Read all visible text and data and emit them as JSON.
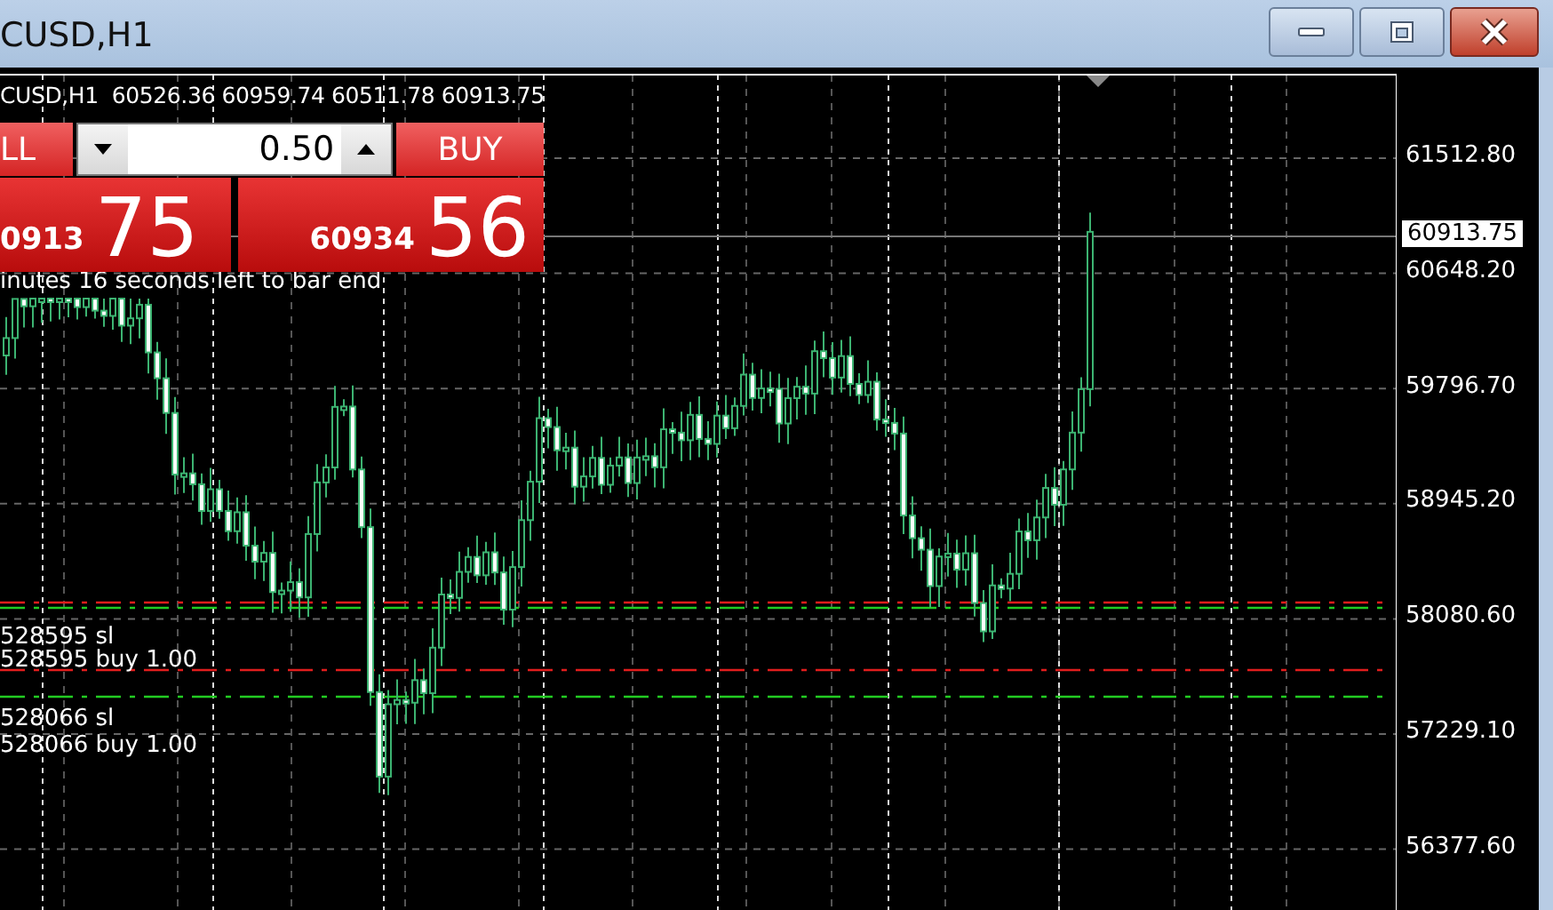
{
  "window": {
    "title": "CUSD,H1",
    "buttons": [
      {
        "kind": "minimize"
      },
      {
        "kind": "maximize"
      },
      {
        "kind": "close"
      }
    ]
  },
  "chart": {
    "info": "CUSD,H1  60526.36 60959.74 60511.78 60913.75",
    "timer": "inutes 16 seconds left to bar end",
    "trade_panel": {
      "sell": {
        "label": "LL",
        "price_prefix": "0913",
        "price_big": "75"
      },
      "lot": "0.50",
      "buy": {
        "label": "BUY",
        "price_prefix": "60934",
        "price_big": "56"
      }
    },
    "order_lines": [
      {
        "label": "528595 sl",
        "kind": "sl"
      },
      {
        "label": "528595 buy 1.00",
        "kind": "buy"
      },
      {
        "label": "528066 sl",
        "kind": "sl"
      },
      {
        "label": "528066 buy 1.00",
        "kind": "buy"
      }
    ],
    "price_axis": [
      "61512.80",
      "60648.20",
      "59796.70",
      "58945.20",
      "58080.60",
      "57229.10",
      "56377.60"
    ],
    "current_price": "60913.75"
  }
}
